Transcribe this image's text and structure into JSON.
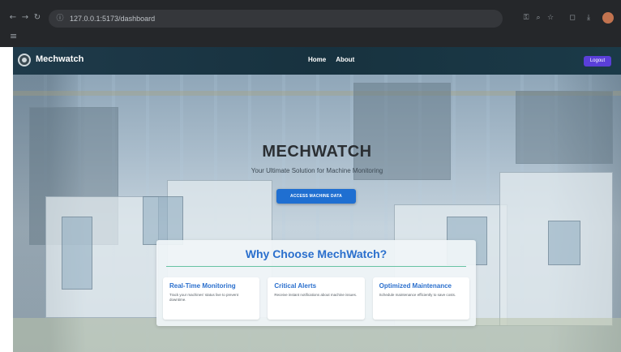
{
  "browser": {
    "url": "127.0.0.1:5173/dashboard"
  },
  "navbar": {
    "brand": "Mechwatch",
    "links": [
      "Home",
      "About"
    ],
    "logout_label": "Logout"
  },
  "hero": {
    "title": "MECHWATCH",
    "subtitle": "Your Ultimate Solution for Machine Monitoring",
    "cta_label": "ACCESS MACHINE DATA"
  },
  "why": {
    "title": "Why Choose MechWatch?",
    "cards": [
      {
        "title": "Real-Time Monitoring",
        "text": "Track your machines' status live to prevent downtime."
      },
      {
        "title": "Critical Alerts",
        "text": "Receive instant notifications about machine issues."
      },
      {
        "title": "Optimized Maintenance",
        "text": "Schedule maintenance efficiently to save costs."
      }
    ]
  },
  "colors": {
    "accent_blue": "#2a6fcd",
    "cta_blue": "#1f6fd1",
    "logout_purple": "#5a3fd9",
    "navbar": "#17323f"
  }
}
